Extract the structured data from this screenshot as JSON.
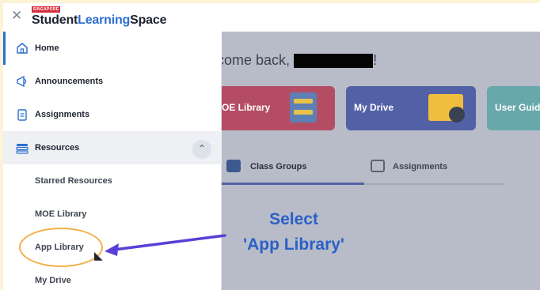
{
  "header": {
    "close_icon": "close-icon",
    "logo_badge": "SINGAPORE",
    "logo_part1": "Student",
    "logo_part2": "Learning",
    "logo_part3": "Space"
  },
  "main": {
    "welcome_prefix": "lcome back,",
    "welcome_suffix": "!",
    "cards": [
      {
        "label": "OE Library",
        "color": "#b44d63"
      },
      {
        "label": "My Drive",
        "color": "#5261a6"
      },
      {
        "label": "User Guide",
        "color": "#67a8ab"
      }
    ],
    "tabs": [
      {
        "label": "Class Groups",
        "icon": "class-groups-icon",
        "active": true
      },
      {
        "label": "Assignments",
        "icon": "assignments-icon",
        "active": false
      }
    ]
  },
  "sidebar": {
    "items": [
      {
        "label": "Home",
        "icon": "home-icon",
        "active": true
      },
      {
        "label": "Announcements",
        "icon": "megaphone-icon"
      },
      {
        "label": "Assignments",
        "icon": "clipboard-icon"
      },
      {
        "label": "Resources",
        "icon": "layers-icon",
        "expanded": true,
        "toggle_icon": "chevron-up-icon"
      }
    ],
    "sub_items": [
      {
        "label": "Starred Resources"
      },
      {
        "label": "MOE Library"
      },
      {
        "label": "App Library",
        "highlighted": true
      },
      {
        "label": "My Drive"
      }
    ]
  },
  "annotation": {
    "line1": "Select",
    "line2": "'App Library'",
    "text_color": "#2c60c7",
    "arrow_color": "#5a3fd6",
    "ring_color": "#f2b04a"
  }
}
